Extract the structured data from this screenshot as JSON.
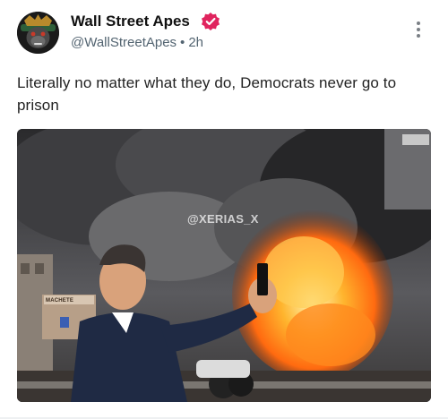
{
  "author": {
    "name": "Wall Street Apes",
    "handle": "@WallStreetApes",
    "time": "2h",
    "separator": "•",
    "avatar_icon": "ape-avatar-icon",
    "verified_icon": "verified-badge-icon",
    "verified_color": "#e0245e"
  },
  "post": {
    "text": "Literally no matter what they do, Democrats never go to prison"
  },
  "media": {
    "watermark": "@XERIAS_X",
    "sign_text": "MACHETE",
    "description_icon": "burning-street-selfie-image"
  },
  "menu": {
    "icon": "more-options-icon"
  },
  "colors": {
    "text_primary": "#0f1419",
    "text_secondary": "#536471",
    "fire": "#ff7a1a"
  }
}
